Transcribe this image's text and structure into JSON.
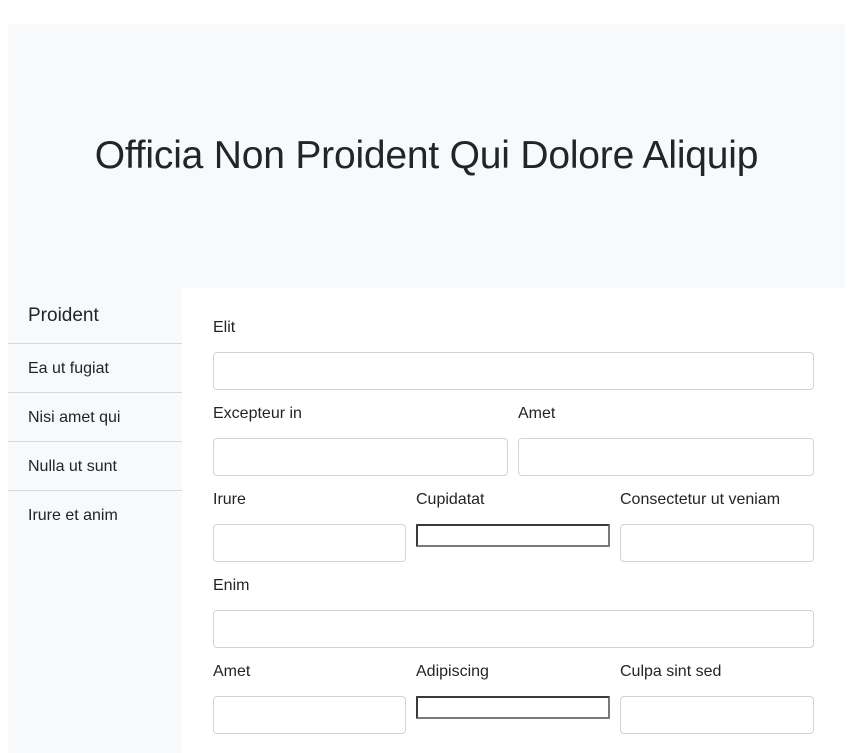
{
  "header": {
    "title": "Officia Non Proident Qui Dolore Aliquip"
  },
  "sidebar": {
    "title": "Proident",
    "items": [
      {
        "label": "Ea ut fugiat"
      },
      {
        "label": "Nisi amet qui"
      },
      {
        "label": "Nulla ut sunt"
      },
      {
        "label": "Irure et anim"
      }
    ]
  },
  "form": {
    "elit": {
      "label": "Elit",
      "value": ""
    },
    "excepteur_in": {
      "label": "Excepteur in",
      "value": ""
    },
    "amet_1": {
      "label": "Amet",
      "value": ""
    },
    "irure": {
      "label": "Irure",
      "value": ""
    },
    "cupidatat": {
      "label": "Cupidatat",
      "value": ""
    },
    "consectetur_ut_veniam": {
      "label": "Consectetur ut veniam",
      "value": ""
    },
    "enim": {
      "label": "Enim",
      "value": ""
    },
    "amet_2": {
      "label": "Amet",
      "value": ""
    },
    "adipiscing": {
      "label": "Adipiscing",
      "value": ""
    },
    "culpa_sint_sed": {
      "label": "Culpa sint sed",
      "value": ""
    }
  }
}
